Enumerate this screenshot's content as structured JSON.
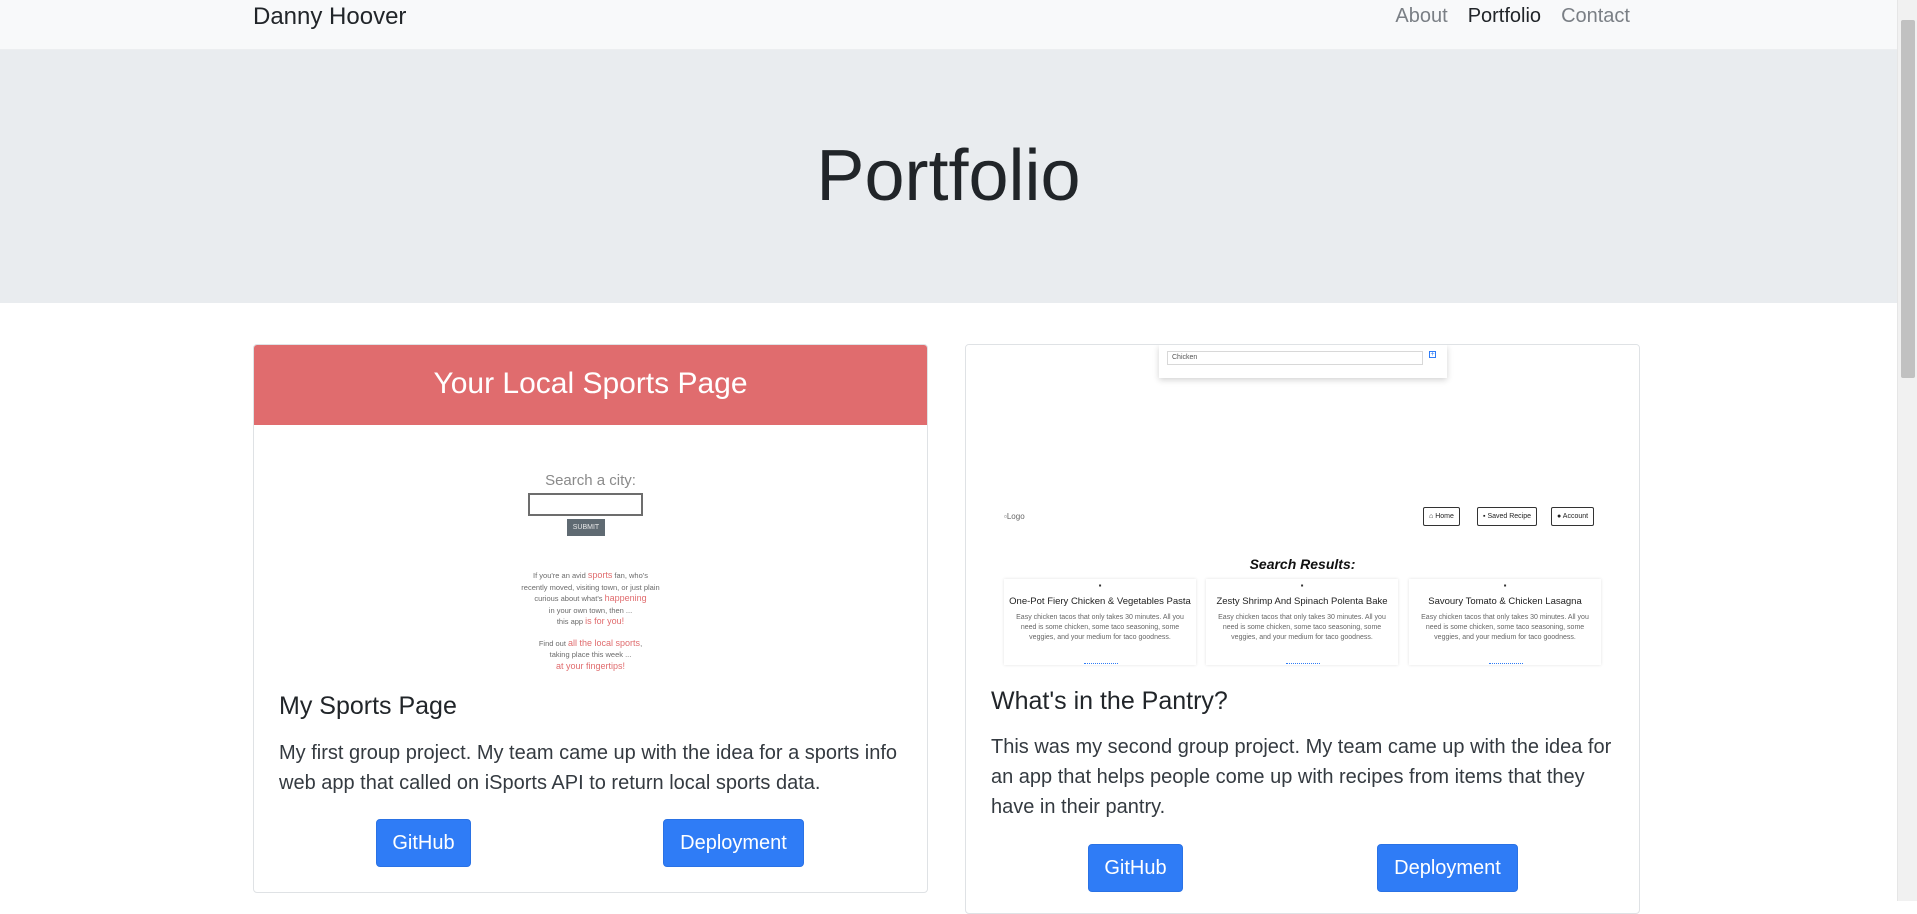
{
  "navbar": {
    "brand": "Danny Hoover",
    "links": [
      {
        "label": "About",
        "active": false
      },
      {
        "label": "Portfolio",
        "active": true
      },
      {
        "label": "Contact",
        "active": false
      }
    ]
  },
  "jumbotron": {
    "title": "Portfolio"
  },
  "projects": [
    {
      "title": "My Sports Page",
      "description": "My first group project. My team came up with the idea for a sports info web app that called on iSports API to return local sports data.",
      "github_label": "GitHub",
      "deploy_label": "Deployment",
      "screenshot": {
        "banner": "Your Local Sports Page",
        "search_label": "Search a city:",
        "submit": "SUBMIT",
        "blurb": [
          [
            "If you're an avid ",
            "sports",
            " fan, who's"
          ],
          [
            "recently moved, visiting town, or just plain"
          ],
          [
            "curious about what's ",
            "happening"
          ],
          [
            "in your own town, then ..."
          ],
          [
            "this app ",
            "is for you!"
          ],
          [
            "Find out ",
            "all the local sports",
            ","
          ],
          [
            "taking place this week ..."
          ],
          [
            "",
            "at your fingertips!"
          ]
        ]
      }
    },
    {
      "title": "What's in the Pantry?",
      "description": "This was my second group project. My team came up with the idea for an app that helps people come up with recipes from items that they have in their pantry.",
      "github_label": "GitHub",
      "deploy_label": "Deployment",
      "screenshot": {
        "search_value": "Chicken",
        "logo_alt": "Logo",
        "nav": [
          "Home",
          "Saved Recipe",
          "Account"
        ],
        "results_title": "Search Results:",
        "recipes": [
          {
            "title": "One-Pot Fiery Chicken & Vegetables Pasta",
            "desc": "Easy chicken tacos that only takes 30 minutes. All you need is some chicken, some taco seasoning, some veggies, and your medium for taco goodness."
          },
          {
            "title": "Zesty Shrimp And Spinach Polenta Bake",
            "desc": "Easy chicken tacos that only takes 30 minutes. All you need is some chicken, some taco seasoning, some veggies, and your medium for taco goodness."
          },
          {
            "title": "Savoury Tomato & Chicken Lasagna",
            "desc": "Easy chicken tacos that only takes 30 minutes. All you need is some chicken, some taco seasoning, some veggies, and your medium for taco goodness."
          }
        ]
      }
    }
  ],
  "colors": {
    "navbar_bg": "#f8f9fa",
    "jumbotron_bg": "#e9ecef",
    "primary": "#2f7cf6",
    "sports_accent": "#e06c6e"
  }
}
